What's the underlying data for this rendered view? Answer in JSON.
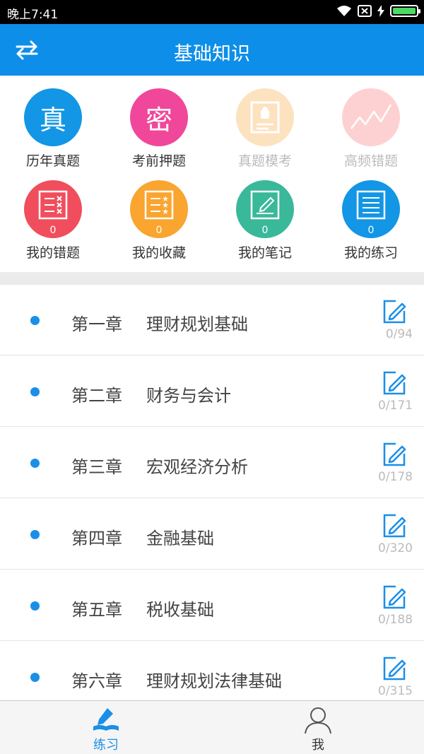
{
  "status": {
    "time": "晚上7:41"
  },
  "header": {
    "title": "基础知识"
  },
  "grid": [
    {
      "label": "历年真题",
      "glyph": "真",
      "color": "#1296e5",
      "dim": false
    },
    {
      "label": "考前押题",
      "glyph": "密",
      "color": "#f0479b",
      "dim": false
    },
    {
      "label": "真题模考",
      "glyph": "",
      "color": "#fde2c0",
      "dim": true
    },
    {
      "label": "高频错题",
      "glyph": "",
      "color": "#fdd1d2",
      "dim": true
    },
    {
      "label": "我的错题",
      "count": "0",
      "color": "#f04e5d",
      "dim": false
    },
    {
      "label": "我的收藏",
      "count": "0",
      "color": "#f9a530",
      "dim": false
    },
    {
      "label": "我的笔记",
      "count": "0",
      "color": "#3ab89a",
      "dim": false
    },
    {
      "label": "我的练习",
      "count": "0",
      "color": "#1296e5",
      "dim": false
    }
  ],
  "chapters": [
    {
      "num": "第一章",
      "title": "理财规划基础",
      "count": "0/94"
    },
    {
      "num": "第二章",
      "title": "财务与会计",
      "count": "0/171"
    },
    {
      "num": "第三章",
      "title": "宏观经济分析",
      "count": "0/178"
    },
    {
      "num": "第四章",
      "title": "金融基础",
      "count": "0/320"
    },
    {
      "num": "第五章",
      "title": "税收基础",
      "count": "0/188"
    },
    {
      "num": "第六章",
      "title": "理财规划法律基础",
      "count": "0/315"
    }
  ],
  "tabs": [
    {
      "label": "练习",
      "active": true
    },
    {
      "label": "我",
      "active": false
    }
  ],
  "colors": {
    "accent": "#0d8ee8",
    "tab_active": "#1a8fe8",
    "tab_inactive": "#333333"
  }
}
